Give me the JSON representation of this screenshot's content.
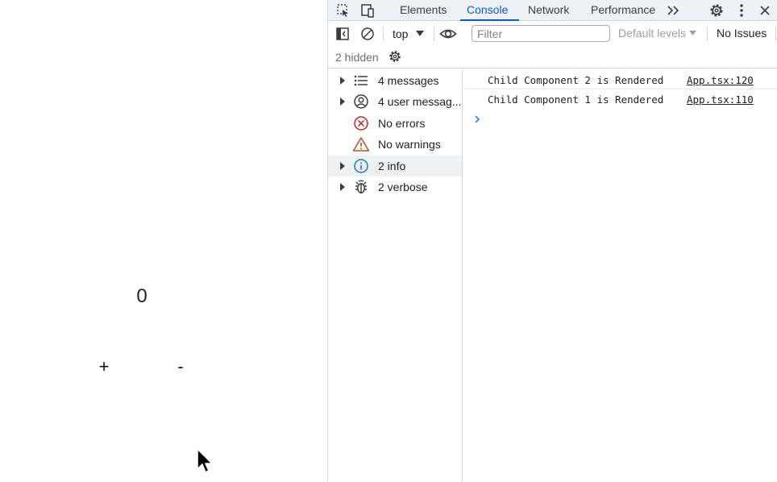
{
  "app": {
    "counter_value": "0",
    "increment_label": "+",
    "decrement_label": "-"
  },
  "devtools": {
    "tabs": [
      {
        "label": "Elements",
        "active": false
      },
      {
        "label": "Console",
        "active": true
      },
      {
        "label": "Network",
        "active": false
      },
      {
        "label": "Performance",
        "active": false
      }
    ],
    "toolbar": {
      "context": "top",
      "filter_placeholder": "Filter",
      "levels": "Default levels",
      "issues": "No Issues",
      "hidden": "2 hidden"
    },
    "sidebar": {
      "items": [
        {
          "label": "4 messages",
          "icon": "list-icon",
          "expandable": true
        },
        {
          "label": "4 user messag...",
          "icon": "user-icon",
          "expandable": true
        },
        {
          "label": "No errors",
          "icon": "error-icon",
          "expandable": false
        },
        {
          "label": "No warnings",
          "icon": "warning-icon",
          "expandable": false
        },
        {
          "label": "2 info",
          "icon": "info-icon",
          "expandable": true,
          "selected": true
        },
        {
          "label": "2 verbose",
          "icon": "bug-icon",
          "expandable": true
        }
      ]
    },
    "console": {
      "messages": [
        {
          "text": "Child Component 2 is Rendered",
          "source": "App.tsx:120"
        },
        {
          "text": "Child Component 1 is Rendered",
          "source": "App.tsx:110"
        }
      ]
    },
    "colors": {
      "accent": "#0b57d0",
      "error": "#c5221f",
      "warning": "#c0501f",
      "info": "#1a73e8"
    }
  }
}
